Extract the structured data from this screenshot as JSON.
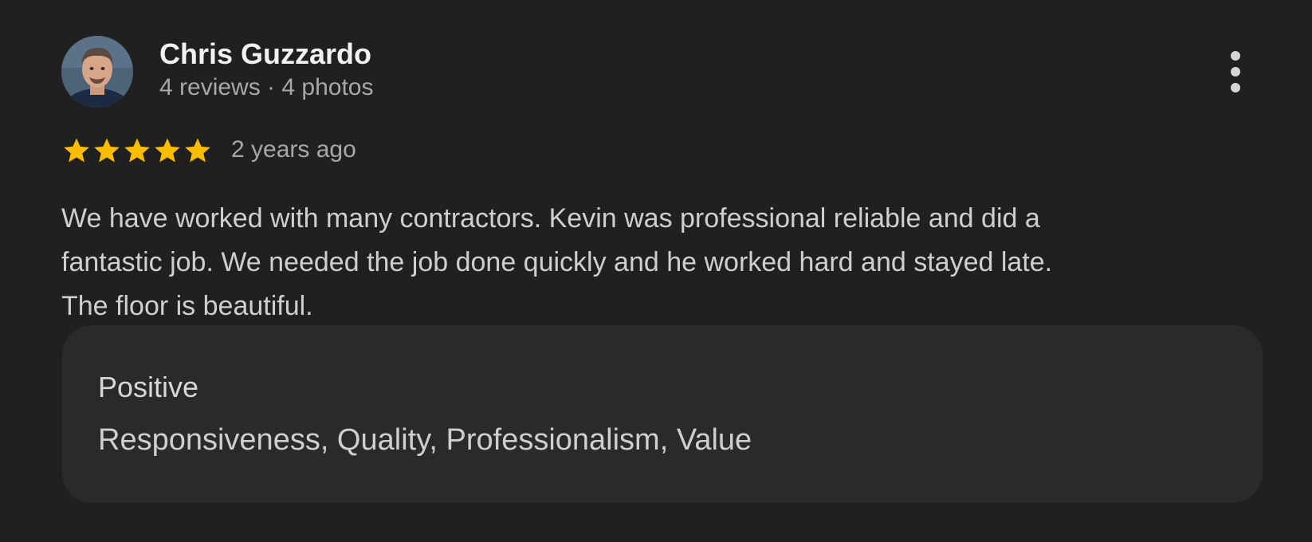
{
  "review": {
    "author_name": "Chris Guzzardo",
    "author_meta": "4 reviews · 4 photos",
    "rating": 5,
    "rating_max": 5,
    "age": "2 years ago",
    "text_lines": [
      "We have worked with many contractors. Kevin was professional reliable and did a",
      "fantastic job. We needed the job done quickly and he worked hard and stayed late.",
      "The floor is beautiful."
    ],
    "attributes": {
      "label": "Positive",
      "value": "Responsiveness, Quality, Professionalism, Value"
    }
  },
  "icons": {
    "avatar": "profile-photo",
    "menu": "more-vert-icon",
    "star": "star-icon"
  },
  "colors": {
    "background": "#202020",
    "card": "#292a2c",
    "star": "#fbbc04",
    "primary_text": "#f1f1f1",
    "secondary_text": "#a8a8a8"
  }
}
